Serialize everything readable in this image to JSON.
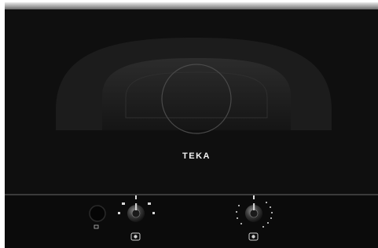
{
  "brand": {
    "logo_text": "TEKA"
  },
  "appliance": {
    "finish_color": "#0f0f0f",
    "trim_color": "#9d9d9d",
    "window_color": "#222222"
  },
  "controls": {
    "push_button": "power-button",
    "function_knob_icons": [
      "defrost-icon",
      "microwave-icon",
      "grill-icon",
      "combi-icon"
    ],
    "timer_knob_marks": "dotted-scale"
  }
}
